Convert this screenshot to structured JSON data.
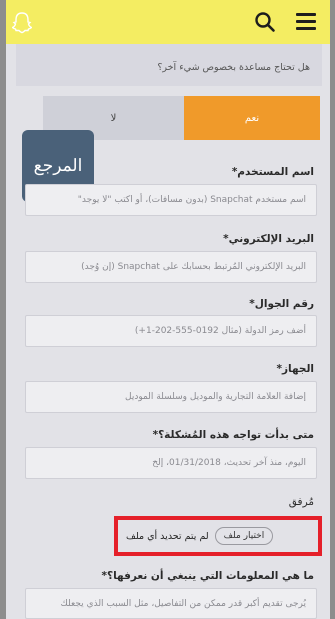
{
  "question": {
    "text": "هل تحتاج مساعدة بخصوص شيء آخر؟"
  },
  "toggle": {
    "no_label": "لا",
    "yes_label": "نعم"
  },
  "watermark": {
    "text": "المرجع"
  },
  "fields": {
    "username": {
      "label": "اسم المستخدم*",
      "placeholder": "اسم مستخدم Snapchat (بدون مسافات)، أو اكتب \"لا يوجد\""
    },
    "email": {
      "label": "البريد الإلكتروني*",
      "placeholder": "البريد الإلكتروني المُرتبط بحسابك على Snapchat (إن وُجد)"
    },
    "phone": {
      "label": "رقم الجوال*",
      "placeholder": "أضف رمز الدولة (مثال 0192-555-202-1+)"
    },
    "device": {
      "label": "الجهاز*",
      "placeholder": "إضافة العلامة التجارية والموديل وسلسلة الموديل"
    },
    "issue_start": {
      "label": "متى بدأت تواجه هذه المُشكلة؟*",
      "placeholder": "اليوم، منذ آخر تحديث، 01/31/2018، إلخ"
    },
    "more_info": {
      "label": "ما هي المعلومات التي ينبغي أن نعرفها؟*",
      "placeholder": "يُرجى تقديم أكبر قدر ممكن من التفاصيل، مثل السبب الذي يجعلك"
    }
  },
  "attachment": {
    "label": "مُرفق",
    "button_label": "اختيار ملف",
    "status": "لم يتم تحديد أي ملف"
  },
  "colors": {
    "header": "#f4ed62",
    "accent": "#f09a2a",
    "highlight": "#e5202a"
  },
  "icons": {
    "ghost": "snapchat-ghost-icon",
    "search": "search-icon",
    "menu": "menu-icon"
  }
}
